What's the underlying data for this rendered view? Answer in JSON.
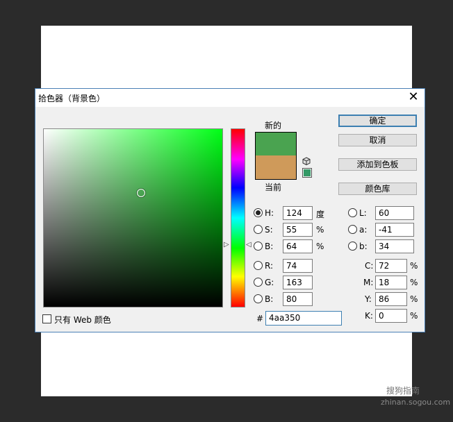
{
  "dialog": {
    "title": "拾色器（背景色）",
    "close_glyph": "✕"
  },
  "preview": {
    "new_label": "新的",
    "current_label": "当前",
    "new_color": "#4aa350",
    "current_color": "#cf9a5a",
    "websafe_color": "#339966"
  },
  "buttons": {
    "ok": "确定",
    "cancel": "取消",
    "add_to_swatches": "添加到色板",
    "color_libraries": "颜色库"
  },
  "hsb": {
    "h_label": "H:",
    "h_value": "124",
    "h_unit": "度",
    "s_label": "S:",
    "s_value": "55",
    "s_unit": "%",
    "b_label": "B:",
    "b_value": "64",
    "b_unit": "%"
  },
  "rgb": {
    "r_label": "R:",
    "r_value": "74",
    "g_label": "G:",
    "g_value": "163",
    "b_label": "B:",
    "b_value": "80"
  },
  "lab": {
    "l_label": "L:",
    "l_value": "60",
    "a_label": "a:",
    "a_value": "-41",
    "b_label": "b:",
    "b_value": "34"
  },
  "cmyk": {
    "c_label": "C:",
    "c_value": "72",
    "c_unit": "%",
    "m_label": "M:",
    "m_value": "18",
    "m_unit": "%",
    "y_label": "Y:",
    "y_value": "86",
    "y_unit": "%",
    "k_label": "K:",
    "k_value": "0",
    "k_unit": "%"
  },
  "hex": {
    "hash": "#",
    "value": "4aa350"
  },
  "web_only": {
    "label": "只有 Web 颜色"
  },
  "watermark": {
    "line1": "搜狗指南",
    "line2": "zhinan.sogou.com"
  },
  "colors": {
    "field_hue": "#00ff16",
    "accent": "#3c7fb1"
  }
}
